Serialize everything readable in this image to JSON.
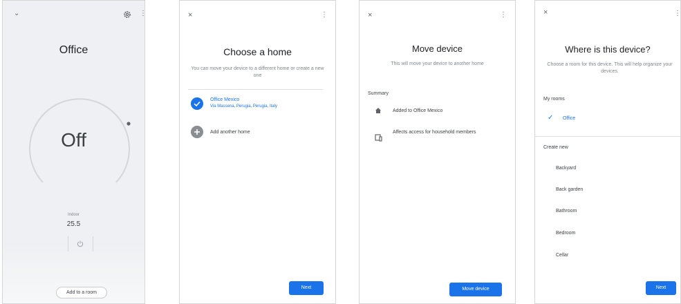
{
  "s1": {
    "room_name": "Office",
    "state": "Off",
    "indoor_label": "Indoor",
    "indoor_value": "25.5",
    "add_room_label": "Add to a room"
  },
  "s2": {
    "title": "Choose a home",
    "subtitle": "You can move your device to a different home or create a new one",
    "home_name": "Office Mexico",
    "home_address": "Via Massena, Perugia, Perugia, Italy",
    "add_home_label": "Add another home",
    "next_label": "Next"
  },
  "s3": {
    "title": "Move device",
    "subtitle": "This will move your device to another home",
    "summary_label": "Summary",
    "row1": "Added to Office Mexico",
    "row2": "Affects access for household members",
    "move_label": "Move device"
  },
  "s4": {
    "title": "Where is this device?",
    "subtitle": "Choose a room for this device. This will help organize your devices.",
    "my_rooms_label": "My rooms",
    "selected_room": "Office",
    "create_new_label": "Create new",
    "rooms": [
      "Backyard",
      "Back garden",
      "Bathroom",
      "Bedroom",
      "Cellar"
    ],
    "next_label": "Next"
  },
  "colors": {
    "accent": "#1a73e8",
    "text": "#202124",
    "muted": "#80868b"
  }
}
